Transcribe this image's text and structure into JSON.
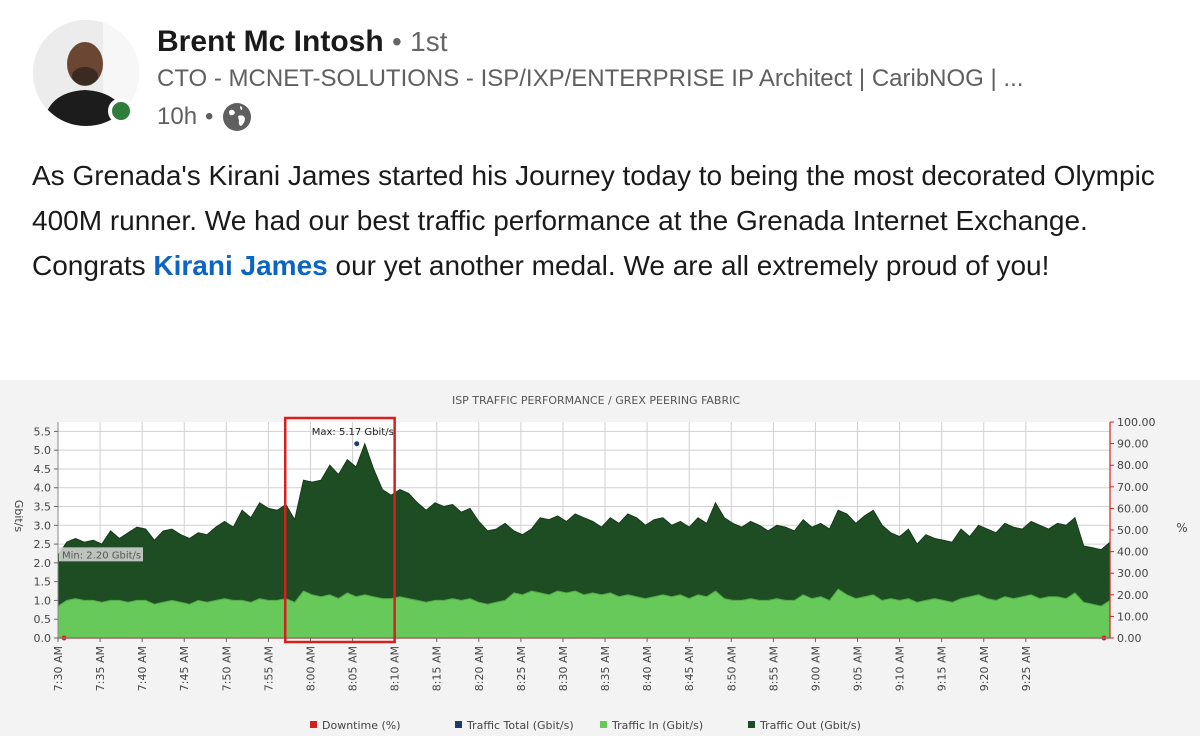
{
  "author": {
    "name": "Brent Mc Intosh",
    "degree": "1st",
    "headline": "CTO - MCNET-SOLUTIONS - ISP/IXP/ENTERPRISE IP Architect | CaribNOG | ...",
    "time": "10h",
    "separator": "•",
    "visibility_icon": "globe-icon",
    "presence_color": "#2f7d3a"
  },
  "post": {
    "line1": "As Grenada's Kirani James started his Journey today to being the most decorated Olympic 400M runner. We had our best traffic performance at the Grenada Internet Exchange.",
    "line2_before": "Congrats ",
    "mention": "Kirani James",
    "line2_after": " our yet another medal. We are all extremely proud of you!",
    "mention_color": "#0a66c2"
  },
  "chart_data": {
    "type": "area",
    "title": "ISP TRAFFIC PERFORMANCE / GREX PEERING FABRIC",
    "ylabel": "Gbit/s",
    "y2label": "%",
    "ylim": [
      0,
      5.75
    ],
    "y2lim": [
      0,
      100
    ],
    "yticks": [
      "0.0",
      "0.5",
      "1.0",
      "1.5",
      "2.0",
      "2.5",
      "3.0",
      "3.5",
      "4.0",
      "4.5",
      "5.0",
      "5.5"
    ],
    "y2ticks": [
      "0.00",
      "10.00",
      "20.00",
      "30.00",
      "40.00",
      "50.00",
      "60.00",
      "70.00",
      "80.00",
      "90.00",
      "100.00"
    ],
    "xticks": [
      "7:30 AM",
      "7:35 AM",
      "7:40 AM",
      "7:45 AM",
      "7:50 AM",
      "7:55 AM",
      "8:00 AM",
      "8:05 AM",
      "8:10 AM",
      "8:15 AM",
      "8:20 AM",
      "8:25 AM",
      "8:30 AM",
      "8:35 AM",
      "8:40 AM",
      "8:45 AM",
      "8:50 AM",
      "8:55 AM",
      "9:00 AM",
      "9:05 AM",
      "9:10 AM",
      "9:15 AM",
      "9:20 AM",
      "9:25 AM"
    ],
    "x_minutes_start": 0,
    "x_minutes_end": 125,
    "grid": true,
    "annotations": [
      {
        "text": "Max: 5.17 Gbit/s",
        "x": 35.5,
        "y": 5.17
      },
      {
        "text": "Min: 2.20 Gbit/s",
        "x": 0,
        "y": 2.2
      }
    ],
    "highlight": {
      "x_start": 27,
      "x_end": 40,
      "color": "#d62020"
    },
    "legend": [
      {
        "name": "Downtime (%)",
        "color": "#d62020"
      },
      {
        "name": "Traffic Total (Gbit/s)",
        "color": "#1f3a6e"
      },
      {
        "name": "Traffic In (Gbit/s)",
        "color": "#66c95a"
      },
      {
        "name": "Traffic Out (Gbit/s)",
        "color": "#1e4d23"
      }
    ],
    "series": [
      {
        "name": "Traffic Total (Gbit/s)",
        "values": [
          2.2,
          2.55,
          2.65,
          2.55,
          2.6,
          2.5,
          2.85,
          2.65,
          2.8,
          2.95,
          2.9,
          2.6,
          2.85,
          2.9,
          2.75,
          2.65,
          2.8,
          2.75,
          2.95,
          3.1,
          2.95,
          3.4,
          3.2,
          3.6,
          3.45,
          3.4,
          3.55,
          3.15,
          4.2,
          4.15,
          4.2,
          4.6,
          4.35,
          4.75,
          4.55,
          5.17,
          4.5,
          3.95,
          3.8,
          3.95,
          3.85,
          3.6,
          3.4,
          3.6,
          3.5,
          3.55,
          3.35,
          3.45,
          3.1,
          2.85,
          2.9,
          3.05,
          2.85,
          2.75,
          2.9,
          3.2,
          3.15,
          3.25,
          3.1,
          3.3,
          3.2,
          3.1,
          2.95,
          3.2,
          3.05,
          3.3,
          3.2,
          3.0,
          3.15,
          3.2,
          3.0,
          3.1,
          2.95,
          3.2,
          3.05,
          3.6,
          3.2,
          3.05,
          2.95,
          3.1,
          3.0,
          2.85,
          3.0,
          2.95,
          2.85,
          3.15,
          2.95,
          3.05,
          2.9,
          3.4,
          3.3,
          3.05,
          3.25,
          3.4,
          3.0,
          2.8,
          2.7,
          2.9,
          2.5,
          2.75,
          2.65,
          2.6,
          2.55,
          2.9,
          2.7,
          3.0,
          2.9,
          2.8,
          3.05,
          2.95,
          2.9,
          3.1,
          3.0,
          2.9,
          3.05,
          3.0,
          3.2,
          2.45,
          2.4,
          2.35,
          2.55
        ],
        "color": "#1e4d23"
      },
      {
        "name": "Traffic In (Gbit/s)",
        "values": [
          0.85,
          1.0,
          1.05,
          1.0,
          1.0,
          0.95,
          1.0,
          1.0,
          0.95,
          1.0,
          1.0,
          0.9,
          0.95,
          1.0,
          0.95,
          0.9,
          1.0,
          0.95,
          1.0,
          1.05,
          1.0,
          1.0,
          0.95,
          1.05,
          1.0,
          1.0,
          1.05,
          0.95,
          1.25,
          1.15,
          1.1,
          1.15,
          1.05,
          1.2,
          1.1,
          1.15,
          1.1,
          1.05,
          1.05,
          1.1,
          1.05,
          1.0,
          0.95,
          1.0,
          1.0,
          1.05,
          1.0,
          1.05,
          0.95,
          0.9,
          0.95,
          1.0,
          1.2,
          1.15,
          1.25,
          1.2,
          1.15,
          1.25,
          1.2,
          1.25,
          1.15,
          1.2,
          1.15,
          1.2,
          1.1,
          1.15,
          1.1,
          1.05,
          1.1,
          1.15,
          1.1,
          1.15,
          1.05,
          1.15,
          1.1,
          1.25,
          1.05,
          1.0,
          1.0,
          1.05,
          1.0,
          1.0,
          1.05,
          1.0,
          1.0,
          1.15,
          1.05,
          1.1,
          1.0,
          1.3,
          1.15,
          1.05,
          1.1,
          1.15,
          1.0,
          1.05,
          1.0,
          1.05,
          0.95,
          1.0,
          1.05,
          1.0,
          0.95,
          1.05,
          1.1,
          1.15,
          1.05,
          1.0,
          1.1,
          1.05,
          1.1,
          1.15,
          1.05,
          1.1,
          1.1,
          1.05,
          1.2,
          0.95,
          0.9,
          0.85,
          1.0
        ],
        "color": "#66c95a"
      },
      {
        "name": "Downtime (%)",
        "values": [
          0,
          0
        ],
        "color": "#d62020"
      }
    ]
  }
}
